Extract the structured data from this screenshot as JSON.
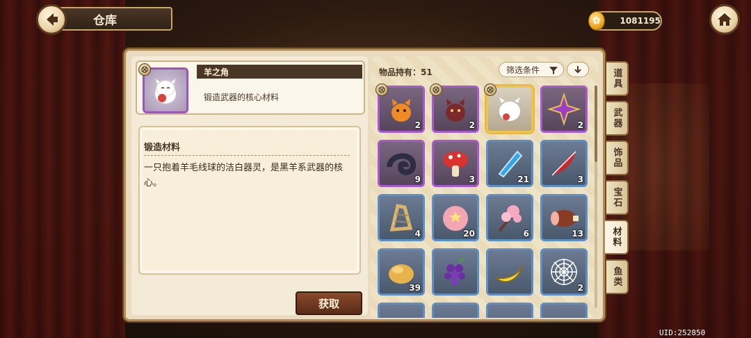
{
  "header": {
    "title": "仓库"
  },
  "currency": {
    "amount": "1081195"
  },
  "uid": "UID:252850",
  "selected_item": {
    "name": "羊之角",
    "short_desc": "锻造武器的核心材料",
    "category": "锻造材料",
    "description": "一只抱着羊毛线球的洁白器灵，是黑羊系武器的核心。"
  },
  "actions": {
    "get_label": "获取"
  },
  "inventory": {
    "count_label": "物品持有：51",
    "filter_label": "筛选条件",
    "slots": [
      {
        "icon": "orange-cat-spirit-icon",
        "qty": "2",
        "rarity": "purple",
        "badge": true
      },
      {
        "icon": "dark-cat-spirit-icon",
        "qty": "2",
        "rarity": "purple",
        "badge": true
      },
      {
        "icon": "white-sheep-spirit-icon",
        "qty": "",
        "rarity": "selected",
        "badge": true
      },
      {
        "icon": "purple-crystal-shuriken-icon",
        "qty": "2",
        "rarity": "purple",
        "badge": false
      },
      {
        "icon": "ram-horn-icon",
        "qty": "9",
        "rarity": "purple",
        "badge": false
      },
      {
        "icon": "red-mushroom-icon",
        "qty": "3",
        "rarity": "purple",
        "badge": false
      },
      {
        "icon": "blue-feather-crystal-icon",
        "qty": "21",
        "rarity": "blue",
        "badge": false
      },
      {
        "icon": "red-feather-icon",
        "qty": "3",
        "rarity": "blue",
        "badge": false
      },
      {
        "icon": "bone-harp-icon",
        "qty": "4",
        "rarity": "blue",
        "badge": false
      },
      {
        "icon": "pink-wool-ball-icon",
        "qty": "20",
        "rarity": "blue",
        "badge": false
      },
      {
        "icon": "cherry-blossom-branch-icon",
        "qty": "6",
        "rarity": "blue",
        "badge": false
      },
      {
        "icon": "meat-roll-icon",
        "qty": "13",
        "rarity": "blue",
        "badge": false
      },
      {
        "icon": "roast-chicken-icon",
        "qty": "39",
        "rarity": "blue",
        "badge": false
      },
      {
        "icon": "grapes-icon",
        "qty": "",
        "rarity": "blue",
        "badge": false
      },
      {
        "icon": "banana-icon",
        "qty": "",
        "rarity": "blue",
        "badge": false
      },
      {
        "icon": "spider-web-icon",
        "qty": "2",
        "rarity": "blue",
        "badge": false
      }
    ]
  },
  "tabs": [
    {
      "label": "道具",
      "active": false
    },
    {
      "label": "武器",
      "active": false
    },
    {
      "label": "饰品",
      "active": false
    },
    {
      "label": "宝石",
      "active": false
    },
    {
      "label": "材料",
      "active": true
    },
    {
      "label": "鱼类",
      "active": false
    }
  ]
}
